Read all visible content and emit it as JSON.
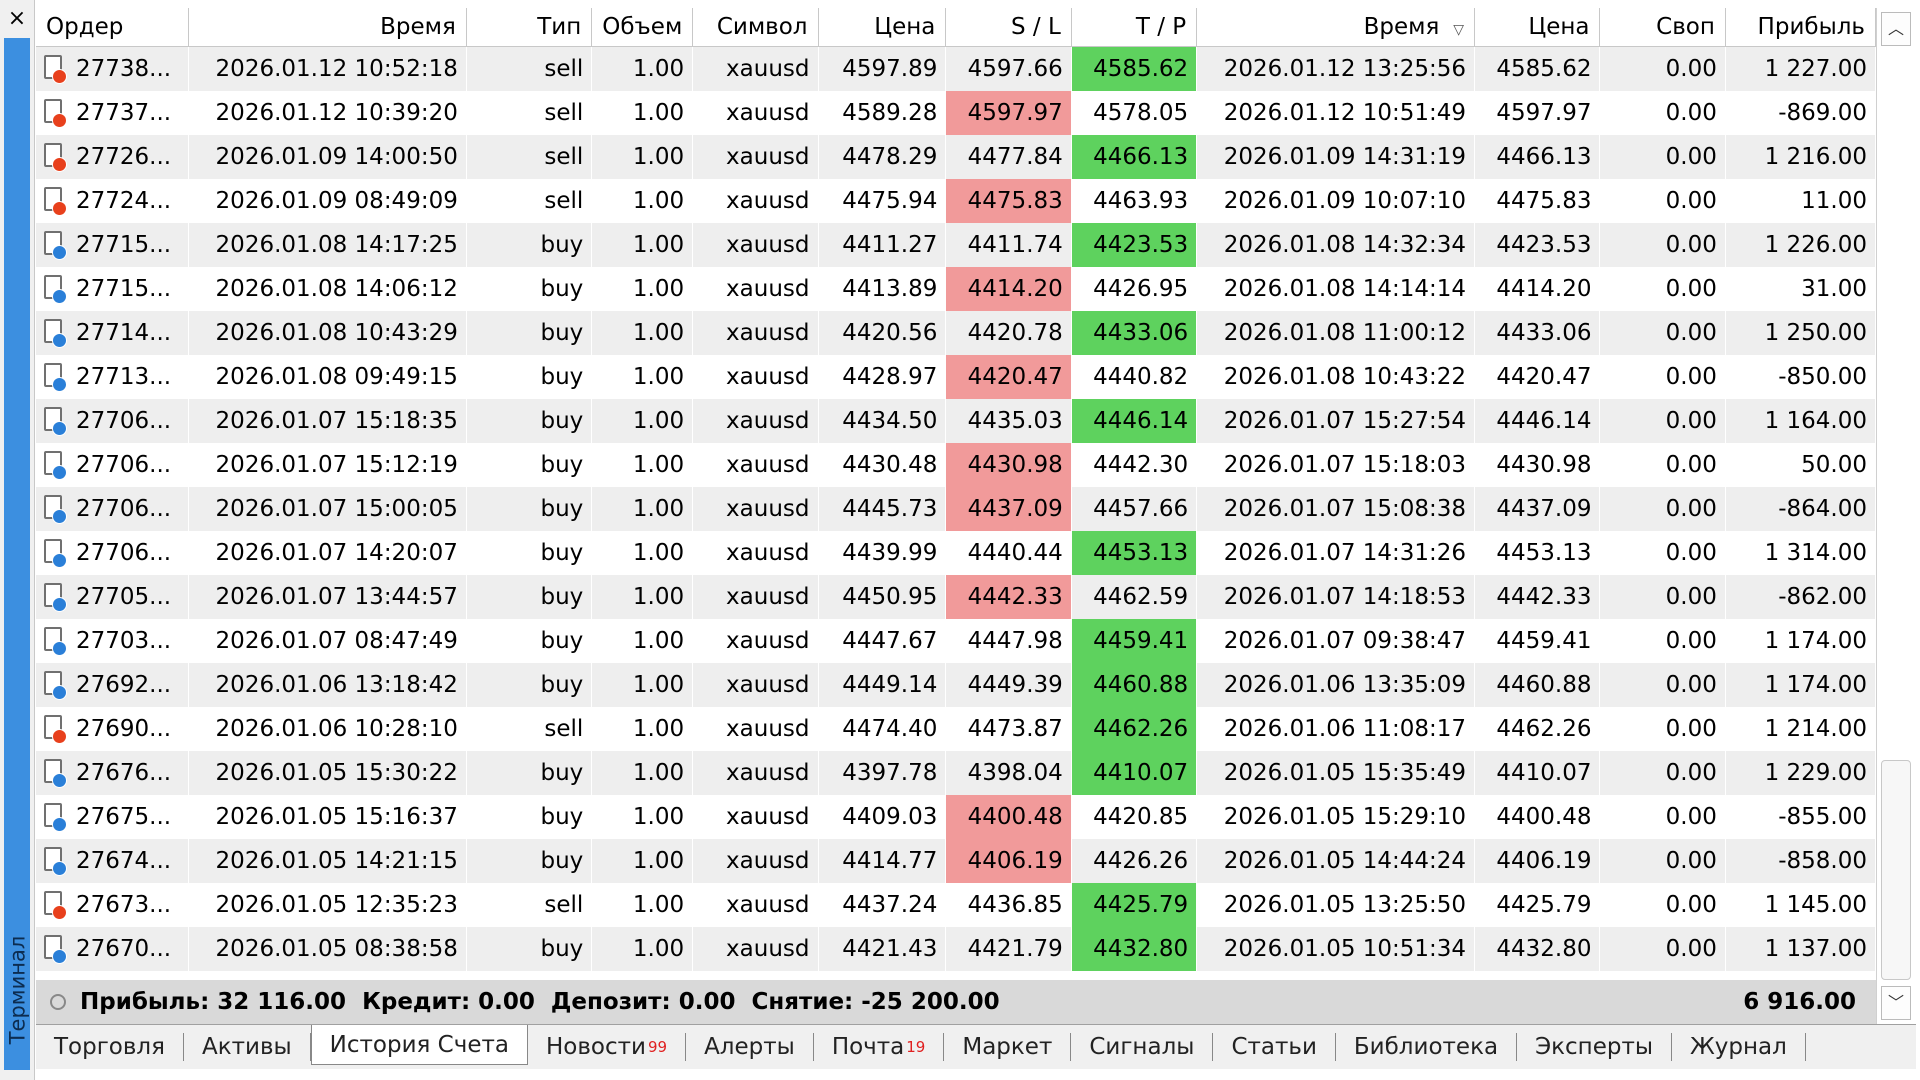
{
  "panel": {
    "title": "Терминал",
    "close_symbol": "×"
  },
  "table": {
    "columns": [
      "Ордер",
      "Время",
      "Тип",
      "Объем",
      "Символ",
      "Цена",
      "S / L",
      "T / P",
      "Время",
      "Цена",
      "Своп",
      "Прибыль"
    ],
    "sorted_column_icon": "sort-desc-icon",
    "rows": [
      {
        "order": "27738...",
        "open_time": "2026.01.12 10:52:18",
        "type": "sell",
        "volume": "1.00",
        "symbol": "xauusd",
        "open_price": "4597.89",
        "sl": "4597.66",
        "tp": "4585.62",
        "close_time": "2026.01.12 13:25:56",
        "close_price": "4585.62",
        "swap": "0.00",
        "profit": "1 227.00",
        "hit": "tp"
      },
      {
        "order": "27737...",
        "open_time": "2026.01.12 10:39:20",
        "type": "sell",
        "volume": "1.00",
        "symbol": "xauusd",
        "open_price": "4589.28",
        "sl": "4597.97",
        "tp": "4578.05",
        "close_time": "2026.01.12 10:51:49",
        "close_price": "4597.97",
        "swap": "0.00",
        "profit": "-869.00",
        "hit": "sl"
      },
      {
        "order": "27726...",
        "open_time": "2026.01.09 14:00:50",
        "type": "sell",
        "volume": "1.00",
        "symbol": "xauusd",
        "open_price": "4478.29",
        "sl": "4477.84",
        "tp": "4466.13",
        "close_time": "2026.01.09 14:31:19",
        "close_price": "4466.13",
        "swap": "0.00",
        "profit": "1 216.00",
        "hit": "tp"
      },
      {
        "order": "27724...",
        "open_time": "2026.01.09 08:49:09",
        "type": "sell",
        "volume": "1.00",
        "symbol": "xauusd",
        "open_price": "4475.94",
        "sl": "4475.83",
        "tp": "4463.93",
        "close_time": "2026.01.09 10:07:10",
        "close_price": "4475.83",
        "swap": "0.00",
        "profit": "11.00",
        "hit": "sl"
      },
      {
        "order": "27715...",
        "open_time": "2026.01.08 14:17:25",
        "type": "buy",
        "volume": "1.00",
        "symbol": "xauusd",
        "open_price": "4411.27",
        "sl": "4411.74",
        "tp": "4423.53",
        "close_time": "2026.01.08 14:32:34",
        "close_price": "4423.53",
        "swap": "0.00",
        "profit": "1 226.00",
        "hit": "tp"
      },
      {
        "order": "27715...",
        "open_time": "2026.01.08 14:06:12",
        "type": "buy",
        "volume": "1.00",
        "symbol": "xauusd",
        "open_price": "4413.89",
        "sl": "4414.20",
        "tp": "4426.95",
        "close_time": "2026.01.08 14:14:14",
        "close_price": "4414.20",
        "swap": "0.00",
        "profit": "31.00",
        "hit": "sl"
      },
      {
        "order": "27714...",
        "open_time": "2026.01.08 10:43:29",
        "type": "buy",
        "volume": "1.00",
        "symbol": "xauusd",
        "open_price": "4420.56",
        "sl": "4420.78",
        "tp": "4433.06",
        "close_time": "2026.01.08 11:00:12",
        "close_price": "4433.06",
        "swap": "0.00",
        "profit": "1 250.00",
        "hit": "tp"
      },
      {
        "order": "27713...",
        "open_time": "2026.01.08 09:49:15",
        "type": "buy",
        "volume": "1.00",
        "symbol": "xauusd",
        "open_price": "4428.97",
        "sl": "4420.47",
        "tp": "4440.82",
        "close_time": "2026.01.08 10:43:22",
        "close_price": "4420.47",
        "swap": "0.00",
        "profit": "-850.00",
        "hit": "sl"
      },
      {
        "order": "27706...",
        "open_time": "2026.01.07 15:18:35",
        "type": "buy",
        "volume": "1.00",
        "symbol": "xauusd",
        "open_price": "4434.50",
        "sl": "4435.03",
        "tp": "4446.14",
        "close_time": "2026.01.07 15:27:54",
        "close_price": "4446.14",
        "swap": "0.00",
        "profit": "1 164.00",
        "hit": "tp"
      },
      {
        "order": "27706...",
        "open_time": "2026.01.07 15:12:19",
        "type": "buy",
        "volume": "1.00",
        "symbol": "xauusd",
        "open_price": "4430.48",
        "sl": "4430.98",
        "tp": "4442.30",
        "close_time": "2026.01.07 15:18:03",
        "close_price": "4430.98",
        "swap": "0.00",
        "profit": "50.00",
        "hit": "sl"
      },
      {
        "order": "27706...",
        "open_time": "2026.01.07 15:00:05",
        "type": "buy",
        "volume": "1.00",
        "symbol": "xauusd",
        "open_price": "4445.73",
        "sl": "4437.09",
        "tp": "4457.66",
        "close_time": "2026.01.07 15:08:38",
        "close_price": "4437.09",
        "swap": "0.00",
        "profit": "-864.00",
        "hit": "sl"
      },
      {
        "order": "27706...",
        "open_time": "2026.01.07 14:20:07",
        "type": "buy",
        "volume": "1.00",
        "symbol": "xauusd",
        "open_price": "4439.99",
        "sl": "4440.44",
        "tp": "4453.13",
        "close_time": "2026.01.07 14:31:26",
        "close_price": "4453.13",
        "swap": "0.00",
        "profit": "1 314.00",
        "hit": "tp"
      },
      {
        "order": "27705...",
        "open_time": "2026.01.07 13:44:57",
        "type": "buy",
        "volume": "1.00",
        "symbol": "xauusd",
        "open_price": "4450.95",
        "sl": "4442.33",
        "tp": "4462.59",
        "close_time": "2026.01.07 14:18:53",
        "close_price": "4442.33",
        "swap": "0.00",
        "profit": "-862.00",
        "hit": "sl"
      },
      {
        "order": "27703...",
        "open_time": "2026.01.07 08:47:49",
        "type": "buy",
        "volume": "1.00",
        "symbol": "xauusd",
        "open_price": "4447.67",
        "sl": "4447.98",
        "tp": "4459.41",
        "close_time": "2026.01.07 09:38:47",
        "close_price": "4459.41",
        "swap": "0.00",
        "profit": "1 174.00",
        "hit": "tp"
      },
      {
        "order": "27692...",
        "open_time": "2026.01.06 13:18:42",
        "type": "buy",
        "volume": "1.00",
        "symbol": "xauusd",
        "open_price": "4449.14",
        "sl": "4449.39",
        "tp": "4460.88",
        "close_time": "2026.01.06 13:35:09",
        "close_price": "4460.88",
        "swap": "0.00",
        "profit": "1 174.00",
        "hit": "tp"
      },
      {
        "order": "27690...",
        "open_time": "2026.01.06 10:28:10",
        "type": "sell",
        "volume": "1.00",
        "symbol": "xauusd",
        "open_price": "4474.40",
        "sl": "4473.87",
        "tp": "4462.26",
        "close_time": "2026.01.06 11:08:17",
        "close_price": "4462.26",
        "swap": "0.00",
        "profit": "1 214.00",
        "hit": "tp"
      },
      {
        "order": "27676...",
        "open_time": "2026.01.05 15:30:22",
        "type": "buy",
        "volume": "1.00",
        "symbol": "xauusd",
        "open_price": "4397.78",
        "sl": "4398.04",
        "tp": "4410.07",
        "close_time": "2026.01.05 15:35:49",
        "close_price": "4410.07",
        "swap": "0.00",
        "profit": "1 229.00",
        "hit": "tp"
      },
      {
        "order": "27675...",
        "open_time": "2026.01.05 15:16:37",
        "type": "buy",
        "volume": "1.00",
        "symbol": "xauusd",
        "open_price": "4409.03",
        "sl": "4400.48",
        "tp": "4420.85",
        "close_time": "2026.01.05 15:29:10",
        "close_price": "4400.48",
        "swap": "0.00",
        "profit": "-855.00",
        "hit": "sl"
      },
      {
        "order": "27674...",
        "open_time": "2026.01.05 14:21:15",
        "type": "buy",
        "volume": "1.00",
        "symbol": "xauusd",
        "open_price": "4414.77",
        "sl": "4406.19",
        "tp": "4426.26",
        "close_time": "2026.01.05 14:44:24",
        "close_price": "4406.19",
        "swap": "0.00",
        "profit": "-858.00",
        "hit": "sl"
      },
      {
        "order": "27673...",
        "open_time": "2026.01.05 12:35:23",
        "type": "sell",
        "volume": "1.00",
        "symbol": "xauusd",
        "open_price": "4437.24",
        "sl": "4436.85",
        "tp": "4425.79",
        "close_time": "2026.01.05 13:25:50",
        "close_price": "4425.79",
        "swap": "0.00",
        "profit": "1 145.00",
        "hit": "tp"
      },
      {
        "order": "27670...",
        "open_time": "2026.01.05 08:38:58",
        "type": "buy",
        "volume": "1.00",
        "symbol": "xauusd",
        "open_price": "4421.43",
        "sl": "4421.79",
        "tp": "4432.80",
        "close_time": "2026.01.05 10:51:34",
        "close_price": "4432.80",
        "swap": "0.00",
        "profit": "1 137.00",
        "hit": "tp"
      }
    ]
  },
  "summary": {
    "text": "Прибыль: 32 116.00  Кредит: 0.00  Депозит: 0.00  Снятие: -25 200.00",
    "total_profit": "6 916.00"
  },
  "tabs": [
    {
      "label": "Торговля",
      "badge": ""
    },
    {
      "label": "Активы",
      "badge": ""
    },
    {
      "label": "История Счета",
      "badge": "",
      "active": true
    },
    {
      "label": "Новости",
      "badge": "99"
    },
    {
      "label": "Алерты",
      "badge": ""
    },
    {
      "label": "Почта",
      "badge": "19"
    },
    {
      "label": "Маркет",
      "badge": ""
    },
    {
      "label": "Сигналы",
      "badge": ""
    },
    {
      "label": "Статьи",
      "badge": ""
    },
    {
      "label": "Библиотека",
      "badge": ""
    },
    {
      "label": "Эксперты",
      "badge": ""
    },
    {
      "label": "Журнал",
      "badge": ""
    }
  ],
  "colors": {
    "sell_dot": "#e8401c",
    "buy_dot": "#2a7fd8",
    "sl_hit": "#f19a9a",
    "tp_hit": "#5ed25e",
    "panel_blue": "#3c8fe0"
  }
}
